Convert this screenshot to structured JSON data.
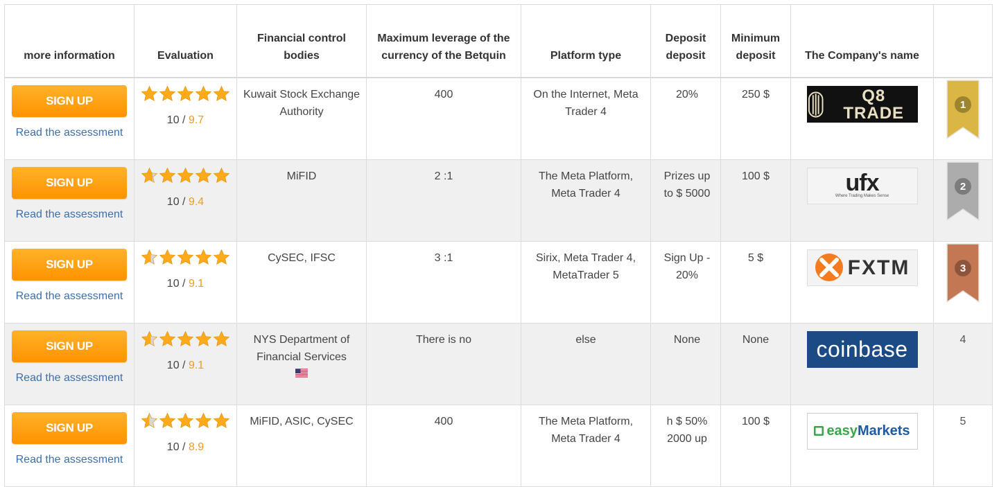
{
  "headers": {
    "more_info": "more information",
    "evaluation": "Evaluation",
    "financial_control": "Financial control bodies",
    "max_leverage": "Maximum leverage of the currency of the Betquin",
    "platform_type": "Platform type",
    "deposit_deposit": "Deposit deposit",
    "min_deposit": "Minimum deposit",
    "company_name": "The Company's name",
    "rank": ""
  },
  "rows": [
    {
      "signup_label": "SIGN UP",
      "read_label": "Read the assessment",
      "stars": 5,
      "score_max": "10",
      "score_sep": " / ",
      "score": "9.7",
      "control": "Kuwait Stock Exchange Authority",
      "leverage": "400",
      "platform": "On the Internet, Meta Trader 4",
      "deposit_bonus": "20%",
      "min_deposit": "250 $",
      "logo_text": "Q8 TRADE",
      "rank": "1",
      "rank_color": "#d9b43a"
    },
    {
      "signup_label": "SIGN UP",
      "read_label": "Read the assessment",
      "stars": 4.7,
      "score_max": "10",
      "score_sep": " / ",
      "score": "9.4",
      "control": "MiFID",
      "leverage": "2 :1",
      "platform": "The Meta Platform, Meta Trader 4",
      "deposit_bonus": "Prizes up to $ 5000",
      "min_deposit": "100 $",
      "logo_text": "ufx",
      "logo_tagline": "Where Trading Makes Sense",
      "rank": "2",
      "rank_color": "#a9a9a9"
    },
    {
      "signup_label": "SIGN UP",
      "read_label": "Read the assessment",
      "stars": 4.6,
      "score_max": "10",
      "score_sep": " / ",
      "score": "9.1",
      "control": "CySEC, IFSC",
      "leverage": "3 :1",
      "platform": "Sirix, Meta Trader 4, MetaTrader 5",
      "deposit_bonus": "Sign Up - 20%",
      "min_deposit": "5 $",
      "logo_text": "FXTM",
      "rank": "3",
      "rank_color": "#c0704a"
    },
    {
      "signup_label": "SIGN UP",
      "read_label": "Read the assessment",
      "stars": 4.6,
      "score_max": "10",
      "score_sep": " / ",
      "score": "9.1",
      "control": "NYS Department of Financial Services",
      "leverage": "There is no",
      "platform": "else",
      "deposit_bonus": "None",
      "min_deposit": "None",
      "logo_text": "coinbase",
      "rank": "4"
    },
    {
      "signup_label": "SIGN UP",
      "read_label": "Read the assessment",
      "stars": 4.5,
      "score_max": "10",
      "score_sep": " / ",
      "score": "8.9",
      "control": "MiFID, ASIC, CySEC",
      "leverage": "400",
      "platform": "The Meta Platform, Meta Trader 4",
      "deposit_bonus": "h $ 50% 2000 up",
      "min_deposit": "100 $",
      "logo_text_a": "easy",
      "logo_text_b": "Markets",
      "rank": "5"
    }
  ],
  "colors": {
    "accent_orange": "#ff9f16",
    "score_orange": "#f39c12",
    "link_blue": "#3c6fae",
    "coinbase_blue": "#1c4a85",
    "fxtm_orange": "#f47b20",
    "ufx_green": "#7cbb20",
    "easy_green": "#3aa64a",
    "easy_blue": "#1d5aa5"
  },
  "icons": {
    "star": "star-icon",
    "flag": "us-flag-icon",
    "ribbon": "rank-ribbon-icon"
  }
}
